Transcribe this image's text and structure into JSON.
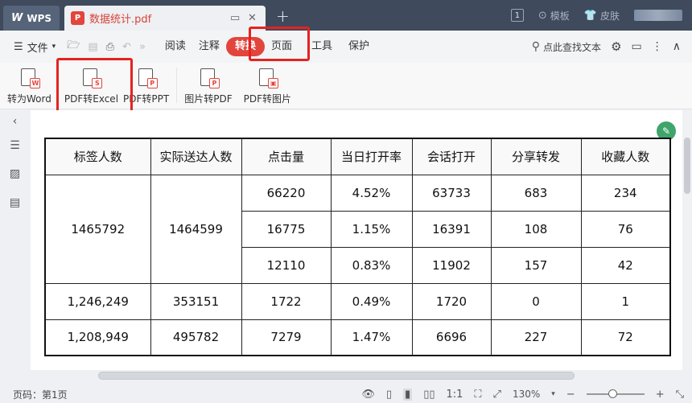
{
  "titlebar": {
    "app_label": "WPS",
    "doc_tab": "数据统计.pdf",
    "page_count_badge": "1",
    "template_label": "模板",
    "skin_label": "皮肤"
  },
  "menubar": {
    "file_label": "文件",
    "tabs": [
      "阅读",
      "注释",
      "转换",
      "页面",
      "工具",
      "保护"
    ],
    "active_tab": "转换",
    "search_label": "点此查找文本"
  },
  "ribbon": {
    "buttons": [
      {
        "label": "转为Word",
        "badge": "W"
      },
      {
        "label": "PDF转Excel",
        "badge": "S"
      },
      {
        "label": "PDF转PPT",
        "badge": "P"
      },
      {
        "label": "图片转PDF",
        "badge": "P"
      },
      {
        "label": "PDF转图片",
        "badge": "▣"
      }
    ]
  },
  "table": {
    "headers": [
      "标签人数",
      "实际送达人数",
      "点击量",
      "当日打开率",
      "会话打开",
      "分享转发",
      "收藏人数"
    ],
    "group1": {
      "tag_count": "1465792",
      "delivered": "1464599",
      "rows": [
        [
          "66220",
          "4.52%",
          "63733",
          "683",
          "234"
        ],
        [
          "16775",
          "1.15%",
          "16391",
          "108",
          "76"
        ],
        [
          "12110",
          "0.83%",
          "11902",
          "157",
          "42"
        ]
      ]
    },
    "rows": [
      [
        "1,246,249",
        "353151",
        "1722",
        "0.49%",
        "1720",
        "0",
        "1"
      ],
      [
        "1,208,949",
        "495782",
        "7279",
        "1.47%",
        "6696",
        "227",
        "72"
      ]
    ]
  },
  "statusbar": {
    "page_info": "页码：第1页",
    "zoom": "130%",
    "zoom_fraction": 0.45
  },
  "colors": {
    "accent": "#e2453c",
    "highlight": "#e42320",
    "titlebar": "#3f4a5c"
  }
}
